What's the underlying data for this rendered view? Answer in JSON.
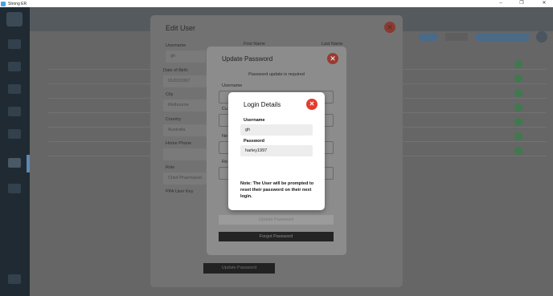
{
  "window": {
    "title": "Strong ER",
    "minimize_glyph": "–",
    "maximize_glyph": "❐",
    "close_glyph": "✕"
  },
  "edit_user": {
    "title": "Edit User",
    "username_label": "Username",
    "username_value": "gh",
    "first_name_label": "First Name",
    "last_name_label": "Last Name",
    "dob_label": "Date of Birth",
    "dob_value": "01/01/1997",
    "city_label": "City",
    "city_value": "Melbourne",
    "country_label": "Country",
    "country_value": "Australia",
    "home_phone_label": "Home Phone",
    "role_label": "Role",
    "role_value": "Chief Pharmacist",
    "ppa_label": "PPA User Key",
    "update_button": "Update Password"
  },
  "update_password": {
    "title": "Update Password",
    "required_message": "Password update is required",
    "username_label": "Username",
    "current_label": "Cu",
    "new_label": "Ne",
    "repeat_label": "Re",
    "submit_button": "Update Password",
    "forgot_button": "Forgot Password"
  },
  "login_details": {
    "title": "Login Details",
    "username_label": "Username",
    "username_value": "gh",
    "password_label": "Password",
    "password_value": "harley1997",
    "note": "Note: The User will be prompted to reset their password on their next login."
  },
  "colors": {
    "close_button": "#e53b2c",
    "forgot_button": "#242424"
  }
}
